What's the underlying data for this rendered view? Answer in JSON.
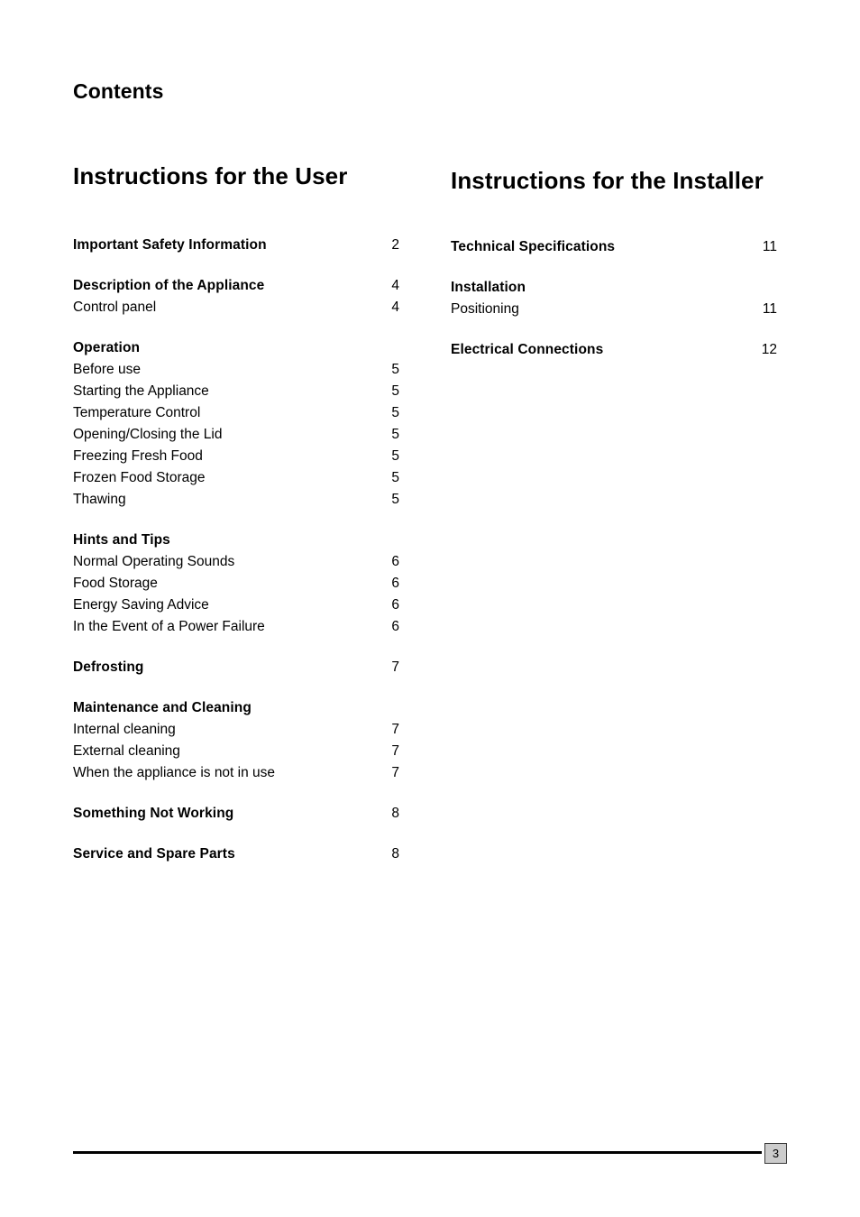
{
  "document": {
    "heading": "Contents",
    "footer": {
      "page_number": "3"
    }
  },
  "columns": {
    "left": {
      "title": "Instructions for the User",
      "groups": [
        {
          "entries": [
            {
              "label": "Important Safety Information",
              "page": "2",
              "level": "head"
            }
          ]
        },
        {
          "entries": [
            {
              "label": "Description of the Appliance",
              "page": "4",
              "level": "head"
            },
            {
              "label": "Control panel",
              "page": "4",
              "level": "sub"
            }
          ]
        },
        {
          "entries": [
            {
              "label": "Operation",
              "page": "",
              "level": "head"
            },
            {
              "label": "Before use",
              "page": "5",
              "level": "sub"
            },
            {
              "label": "Starting the Appliance",
              "page": "5",
              "level": "sub"
            },
            {
              "label": "Temperature Control",
              "page": "5",
              "level": "sub"
            },
            {
              "label": "Opening/Closing the Lid",
              "page": "5",
              "level": "sub"
            },
            {
              "label": "Freezing Fresh Food",
              "page": "5",
              "level": "sub"
            },
            {
              "label": "Frozen Food Storage",
              "page": "5",
              "level": "sub"
            },
            {
              "label": "Thawing",
              "page": "5",
              "level": "sub"
            }
          ]
        },
        {
          "entries": [
            {
              "label": "Hints and Tips",
              "page": "",
              "level": "head"
            },
            {
              "label": "Normal Operating Sounds",
              "page": "6",
              "level": "sub"
            },
            {
              "label": "Food Storage",
              "page": "6",
              "level": "sub"
            },
            {
              "label": "Energy Saving Advice",
              "page": "6",
              "level": "sub"
            },
            {
              "label": "In the Event of a Power Failure",
              "page": "6",
              "level": "sub"
            }
          ]
        },
        {
          "entries": [
            {
              "label": "Defrosting",
              "page": "7",
              "level": "head"
            }
          ]
        },
        {
          "entries": [
            {
              "label": "Maintenance and Cleaning",
              "page": "",
              "level": "head"
            },
            {
              "label": "Internal cleaning",
              "page": "7",
              "level": "sub"
            },
            {
              "label": "External cleaning",
              "page": "7",
              "level": "sub"
            },
            {
              "label": "When the appliance is not in use",
              "page": "7",
              "level": "sub"
            }
          ]
        },
        {
          "entries": [
            {
              "label": "Something Not Working",
              "page": "8",
              "level": "head"
            }
          ]
        },
        {
          "entries": [
            {
              "label": "Service and Spare Parts",
              "page": "8",
              "level": "head"
            }
          ]
        }
      ]
    },
    "right": {
      "title": "Instructions for the Installer",
      "groups": [
        {
          "entries": [
            {
              "label": "Technical Specifications",
              "page": "11",
              "level": "head"
            }
          ]
        },
        {
          "entries": [
            {
              "label": "Installation",
              "page": "",
              "level": "head"
            },
            {
              "label": "Positioning",
              "page": "11",
              "level": "sub"
            }
          ]
        },
        {
          "entries": [
            {
              "label": "Electrical Connections",
              "page": "12",
              "level": "head"
            }
          ]
        }
      ]
    }
  }
}
